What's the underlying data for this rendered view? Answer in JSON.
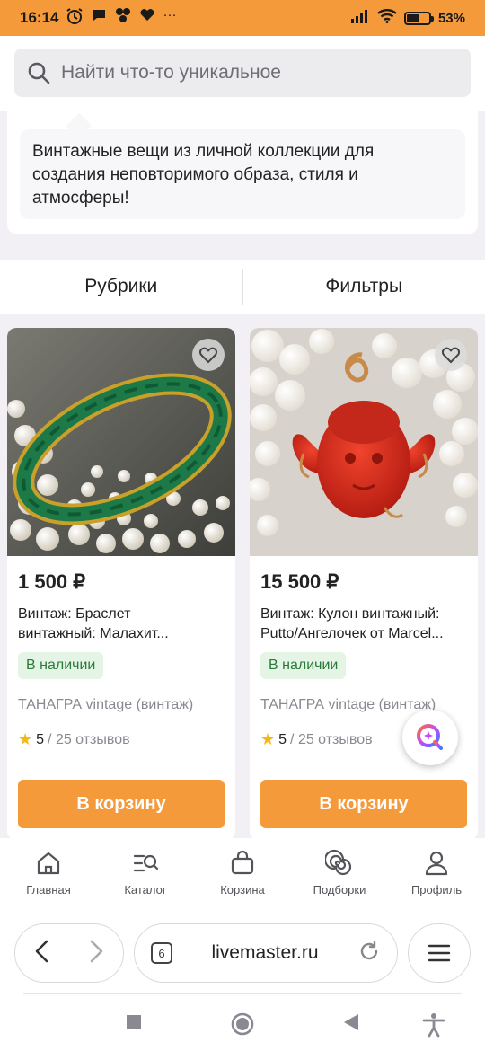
{
  "status_bar": {
    "time": "16:14",
    "notification_icons": [
      "alarm-icon",
      "chat-icon",
      "apps-icon",
      "heart-icon",
      "more-icon"
    ],
    "more_dots": "···",
    "battery": "53%",
    "battery_level": 0.53
  },
  "search": {
    "placeholder": "Найти что-то уникальное",
    "icon": "search-icon"
  },
  "description": {
    "lines": [
      "Винтажные вещи из личной коллекции для",
      "создания неповторимого образа, стиля и",
      "атмосферы!"
    ]
  },
  "tabs": [
    {
      "label": "Рубрики"
    },
    {
      "label": "Фильтры"
    }
  ],
  "products": [
    {
      "price": "1 500 ₽",
      "title_lines": [
        "Винтаж: Браслет",
        "винтажный: Малахит..."
      ],
      "availability": "В наличии",
      "shop": "ТАНАГРА vintage (винтаж)",
      "rating": "5",
      "reviews": "/ 25 отзывов",
      "cart_label": "В корзину",
      "image": "malachite-bracelet-photo"
    },
    {
      "price": "15 500 ₽",
      "title_lines": [
        "Винтаж: Кулон винтажный:",
        "Putto/Ангелочек от Marcel..."
      ],
      "availability": "В наличии",
      "shop": "ТАНАГРА vintage (винтаж)",
      "rating": "5",
      "reviews": "/ 25 отзывов",
      "cart_label": "В корзину",
      "image": "coral-angel-pendant-photo"
    }
  ],
  "bottom_nav": [
    {
      "label": "Главная",
      "icon": "home-icon"
    },
    {
      "label": "Каталог",
      "icon": "catalog-icon"
    },
    {
      "label": "Корзина",
      "icon": "basket-icon"
    },
    {
      "label": "Подборки",
      "icon": "collections-icon"
    },
    {
      "label": "Профиль",
      "icon": "profile-icon"
    }
  ],
  "browser": {
    "url": "livemaster.ru",
    "tab_count": "6"
  },
  "colors": {
    "accent": "#f59a3b",
    "badge_bg": "#e4f5e6",
    "badge_text": "#2a7a38",
    "star": "#f5b915"
  }
}
